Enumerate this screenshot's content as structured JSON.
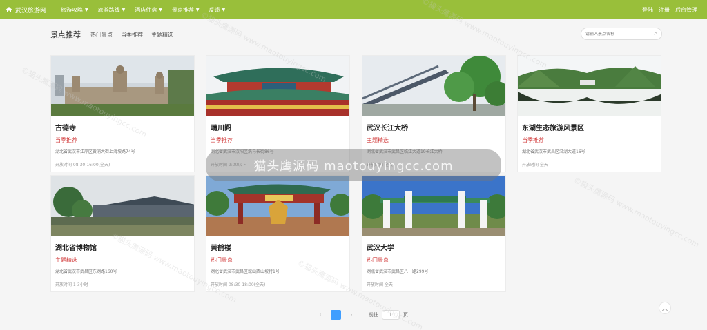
{
  "nav": {
    "brand": "武汉旅游网",
    "items": [
      {
        "label": "旅游攻略"
      },
      {
        "label": "旅游路线"
      },
      {
        "label": "酒店住宿"
      },
      {
        "label": "景点推荐"
      },
      {
        "label": "反馈"
      }
    ],
    "right": {
      "login": "登陆",
      "register": "注册",
      "admin": "后台管理"
    }
  },
  "section": {
    "title": "景点推荐",
    "tabs": [
      "热门景点",
      "当季推荐",
      "主题精选"
    ],
    "search_placeholder": "请输入景点名称"
  },
  "cards": [
    {
      "name": "古德寺",
      "tag": "当季推荐",
      "address": "湖北省武汉市江岸区黄浦大街上滑坡路74号",
      "hours": "开放时间 08:30-16:00(全天)"
    },
    {
      "name": "晴川阁",
      "tag": "当季推荐",
      "address": "湖北省武汉市汉阳区洗马长街86号",
      "hours": "开放时间 9:00以下"
    },
    {
      "name": "武汉长江大桥",
      "tag": "主题精选",
      "address": "湖北省武汉市武昌区临江大道19长江大桥",
      "hours": "开放时间 全天"
    },
    {
      "name": "东湖生态旅游风景区",
      "tag": "当季推荐",
      "address": "湖北省武汉市武昌区沿湖大道16号",
      "hours": "开放时间 全天"
    },
    {
      "name": "湖北省博物馆",
      "tag": "主题精选",
      "address": "湖北省武汉市武昌区东湖路160号",
      "hours": "开放时间 1-3小时"
    },
    {
      "name": "黄鹤楼",
      "tag": "热门景点",
      "address": "湖北省武汉市武昌区蛇山西山坡特1号",
      "hours": "开放时间 08:30-18:00(全天)"
    },
    {
      "name": "武汉大学",
      "tag": "热门景点",
      "address": "湖北省武汉市武昌区八一路299号",
      "hours": "开放时间 全天"
    }
  ],
  "pagination": {
    "prev": "‹",
    "current": "1",
    "next": "›",
    "goto_label": "前往",
    "goto_value": "1",
    "page_suffix": "页"
  },
  "watermark": {
    "banner": "猫头鹰源码 maotouyingcc.com",
    "tile": "©猫头鹰源码 www.maotouyingcc.com"
  },
  "colors": {
    "nav_bg": "#99bf3a",
    "tag_red": "#d23b3b",
    "pager_active": "#409eff"
  }
}
